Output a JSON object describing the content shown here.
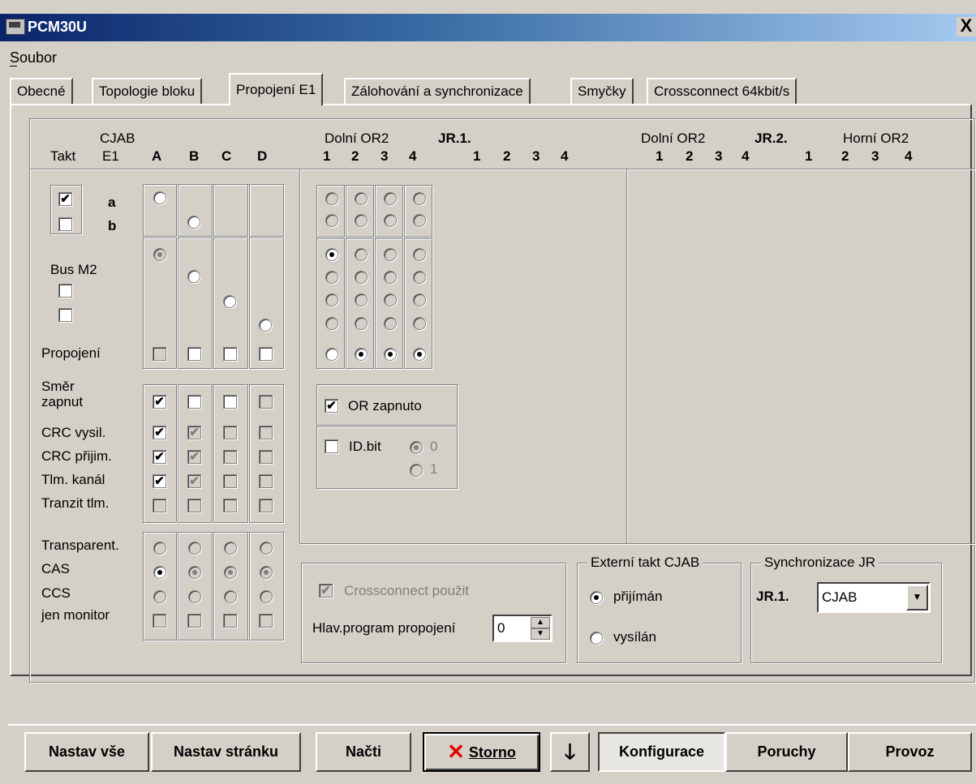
{
  "window": {
    "title": "PCM30U",
    "close": "X"
  },
  "menu": {
    "soubor": "Soubor"
  },
  "tabs": [
    "Obecné",
    "Topologie bloku",
    "Propojení E1",
    "Zálohování a synchronizace",
    "Smyčky",
    "Crossconnect 64kbit/s"
  ],
  "header": {
    "cjab": "CJAB",
    "takt": "Takt",
    "e1": "E1",
    "cols": [
      "A",
      "B",
      "C",
      "D"
    ],
    "dolni_or2_1": "Dolní OR2",
    "jr1": "JR.1.",
    "dolni_or2_2": "Dolní OR2",
    "jr2": "JR.2.",
    "horni_or2": "Horní OR2",
    "nums1": [
      "1",
      "2",
      "3",
      "4",
      "1",
      "2",
      "3",
      "4"
    ],
    "nums2": [
      "1",
      "2",
      "3",
      "4",
      "1",
      "2",
      "3",
      "4"
    ]
  },
  "left": {
    "a": "a",
    "b": "b",
    "bus_m2": "Bus M2",
    "propojeni": "Propojení",
    "smer": "Směr",
    "zapnut": "zapnut",
    "crc_vysil": "CRC vysil.",
    "crc_prijim": "CRC přijim.",
    "tlm_kanal": "Tlm. kanál",
    "tranzit": "Tranzit tlm.",
    "transparent": "Transparent.",
    "cas": "CAS",
    "ccs": "CCS",
    "jen_monitor": "jen monitor"
  },
  "or_panel": {
    "or_zapnuto": "OR zapnuto",
    "id_bit": "ID.bit",
    "r0": "0",
    "r1": "1"
  },
  "crossconnect": {
    "used": "Crossconnect použit",
    "hlav": "Hlav.program propojení",
    "value": "0"
  },
  "ext_takt": {
    "legend": "Externí takt CJAB",
    "prijiman": "přijímán",
    "vysilan": "vysílán"
  },
  "sync": {
    "legend": "Synchronizace JR",
    "jr1": "JR.1.",
    "value": "CJAB"
  },
  "buttons": {
    "nastav_vse": "Nastav vše",
    "nastav_stranku": "Nastav stránku",
    "nacti": "Načti",
    "storno": "Storno",
    "konfigurace": "Konfigurace",
    "poruchy": "Poruchy",
    "provoz": "Provoz"
  }
}
